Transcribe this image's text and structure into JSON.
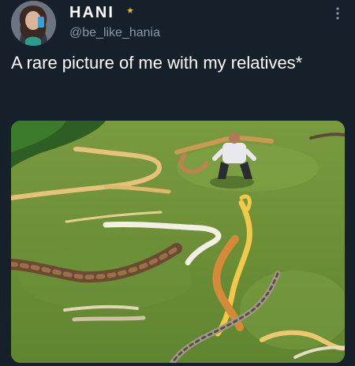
{
  "user": {
    "display_name": "HANI",
    "handle": "@be_like_hania",
    "badge_icon": "crescent-moon-star-icon",
    "avatar_icon": "avatar-photo"
  },
  "tweet": {
    "text": "A rare picture of me with my relatives*"
  },
  "media": {
    "description_icon": "snakes-photo"
  },
  "controls": {
    "more_icon": "more-vertical-icon"
  },
  "colors": {
    "background": "#15202b",
    "text": "#ffffff",
    "secondary": "#8899a6",
    "accent_badge": "#f5b82e"
  }
}
